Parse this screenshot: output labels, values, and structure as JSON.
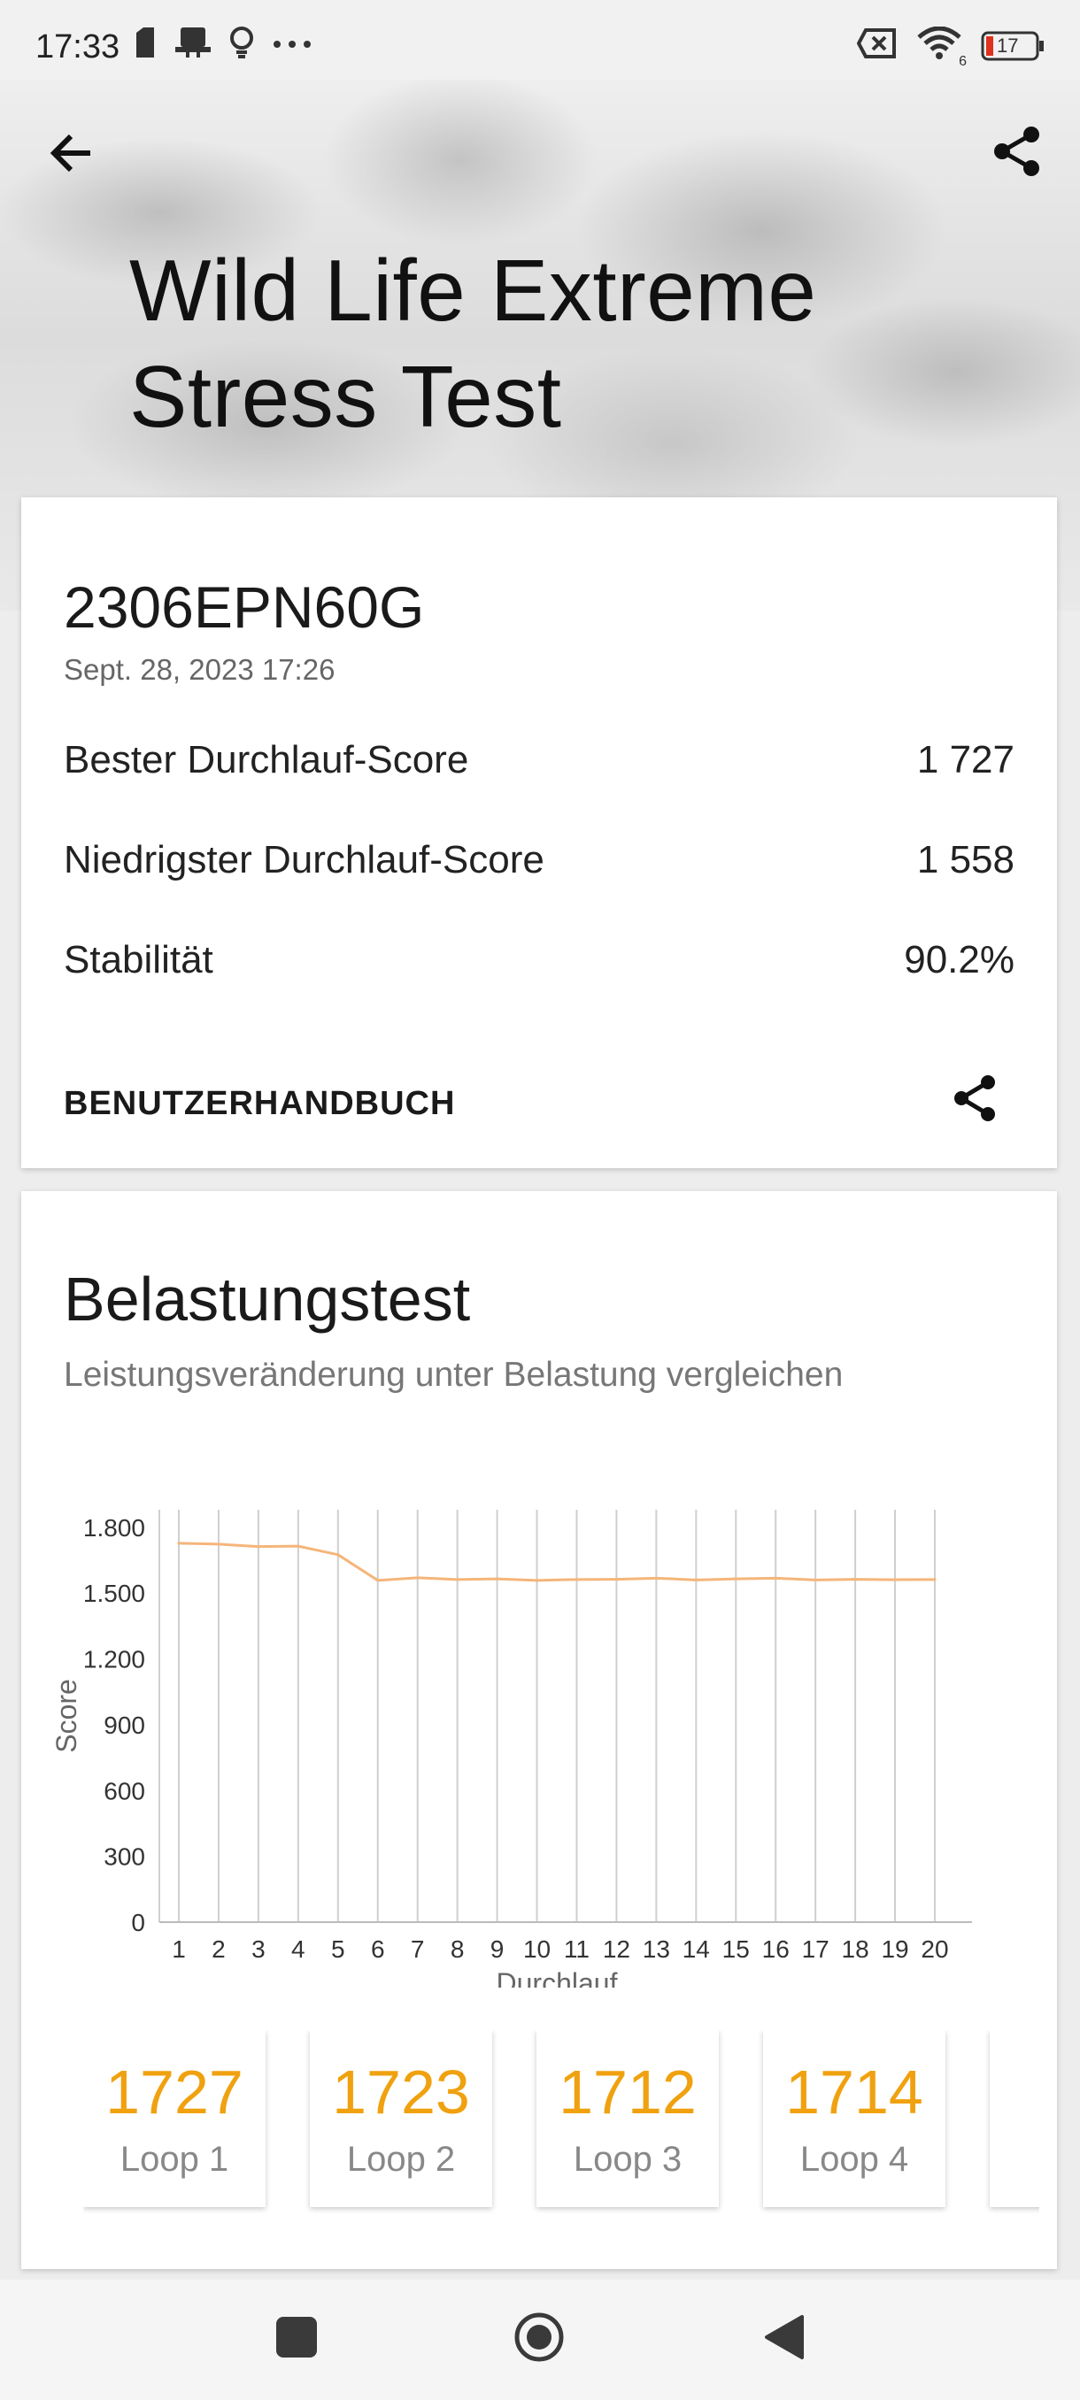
{
  "status_bar": {
    "time": "17:33",
    "battery": "17",
    "wifi_badge": "6",
    "icons_left": [
      "sim-card-icon",
      "printer-icon",
      "bulb-icon",
      "more-dots-icon"
    ],
    "icons_right": [
      "no-sim-icon",
      "wifi-icon",
      "battery-icon"
    ]
  },
  "header": {
    "title_line1": "Wild Life Extreme",
    "title_line2": "Stress Test"
  },
  "result_card": {
    "device": "2306EPN60G",
    "date": "Sept. 28, 2023 17:26",
    "rows": [
      {
        "label": "Bester Durchlauf-Score",
        "value": "1 727"
      },
      {
        "label": "Niedrigster Durchlauf-Score",
        "value": "1 558"
      },
      {
        "label": "Stabilität",
        "value": "90.2%"
      }
    ],
    "manual_label": "BENUTZERHANDBUCH"
  },
  "stress_section": {
    "title": "Belastungstest",
    "subtitle": "Leistungsveränderung unter Belastung vergleichen"
  },
  "chart_data": {
    "type": "line",
    "title": "",
    "xlabel": "Durchlauf",
    "ylabel": "Score",
    "x": [
      1,
      2,
      3,
      4,
      5,
      6,
      7,
      8,
      9,
      10,
      11,
      12,
      13,
      14,
      15,
      16,
      17,
      18,
      19,
      20
    ],
    "yticks": [
      0,
      300,
      600,
      900,
      1200,
      1500,
      1800
    ],
    "ytick_labels": [
      "0",
      "300",
      "600",
      "900",
      "1.200",
      "1.500",
      "1.800"
    ],
    "ylim": [
      0,
      1880
    ],
    "grid": "vertical",
    "series": [
      {
        "values": [
          1727,
          1723,
          1712,
          1714,
          1675,
          1558,
          1570,
          1562,
          1565,
          1558,
          1562,
          1563,
          1568,
          1560,
          1565,
          1568,
          1560,
          1563,
          1561,
          1562
        ],
        "color": "#f5b57a"
      }
    ]
  },
  "loops": [
    {
      "value": "1727",
      "label": "Loop 1"
    },
    {
      "value": "1723",
      "label": "Loop 2"
    },
    {
      "value": "1712",
      "label": "Loop 3"
    },
    {
      "value": "1714",
      "label": "Loop 4"
    },
    {
      "value": "",
      "label": ""
    }
  ],
  "colors": {
    "accent_orange": "#f0a10f",
    "line": "#f5b57a"
  }
}
